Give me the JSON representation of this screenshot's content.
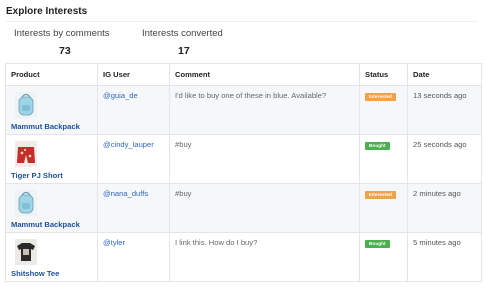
{
  "page": {
    "title": "Explore Interests"
  },
  "stats": [
    {
      "label": "Interests by comments",
      "value": "73"
    },
    {
      "label": "Interests converted",
      "value": "17"
    }
  ],
  "table": {
    "headers": [
      "Product",
      "IG User",
      "Comment",
      "Status",
      "Date"
    ],
    "rows": [
      {
        "product": "Mammut Backpack",
        "product_icon": "backpack-thumbnail",
        "user": "@guia_de",
        "comment": "I'd like to buy one of these in blue. Available?",
        "status": "Interested",
        "status_color": "#f0a24a",
        "date": "13 seconds ago"
      },
      {
        "product": "Tiger PJ Short",
        "product_icon": "shorts-thumbnail",
        "user": "@cindy_lauper",
        "comment": "#buy",
        "status": "Bought",
        "status_color": "#4cb050",
        "date": "25 seconds ago"
      },
      {
        "product": "Mammut Backpack",
        "product_icon": "backpack-thumbnail",
        "user": "@nana_duffs",
        "comment": "#buy",
        "status": "Interested",
        "status_color": "#f0a24a",
        "date": "2 minutes ago"
      },
      {
        "product": "Shitshow Tee",
        "product_icon": "tshirt-thumbnail",
        "user": "@tyler",
        "comment": "I link this. How do I buy?",
        "status": "Bought",
        "status_color": "#4cb050",
        "date": "5 minutes ago"
      }
    ]
  }
}
